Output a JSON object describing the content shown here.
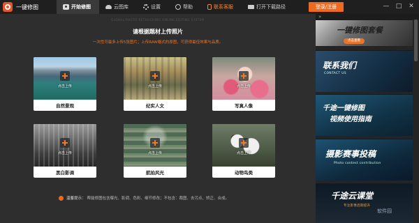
{
  "app": {
    "title": "一键修图"
  },
  "nav": {
    "items": [
      {
        "label": "开始修图",
        "icon": "camera-icon",
        "active": true
      },
      {
        "label": "云图库",
        "icon": "cloud-icon"
      },
      {
        "label": "设置",
        "icon": "gear-icon"
      },
      {
        "label": "帮助",
        "icon": "help-icon"
      },
      {
        "label": "联系客服",
        "icon": "phone-icon",
        "color": "#f08a3c"
      },
      {
        "label": "打开下载路径",
        "icon": "folder-icon"
      }
    ],
    "login_label": "登录/注册"
  },
  "window_controls": {
    "minimize": "—",
    "maximize": "□",
    "close": "✕"
  },
  "main": {
    "watermark": "GLOBAL PHOTO RETOUCHING ONLINE EDITING SYSTEM",
    "upload_title": "请根据题材上传照片",
    "upload_hint": "一次性可最多上传5张图片；上传RAW格式的原图，可获得最佳效果与品质。",
    "upload_action": "点击上传",
    "categories": [
      {
        "label": "自然景观"
      },
      {
        "label": "纪实人文"
      },
      {
        "label": "写真人像"
      },
      {
        "label": "黑白影调"
      },
      {
        "label": "航拍风光"
      },
      {
        "label": "动物鸟类"
      }
    ],
    "tip_label": "温馨提示：",
    "tip_text": "帮能修图包含曝光、影调、色彩、细节修改；不包含：裁图、去污点、矫正、合成。"
  },
  "sidebar": {
    "arrows": "»",
    "banners": [
      {
        "title": "一键修图套餐",
        "pill": "点击查看"
      },
      {
        "title": "联系我们",
        "sub": "CONTACT US"
      },
      {
        "title": "千途一键修图",
        "title2": "视频使用指南"
      },
      {
        "title": "摄影赛事投稿",
        "sub": "Photo contest contribution"
      },
      {
        "title": "千途云课堂",
        "sub": "专注影像后期提升"
      }
    ]
  },
  "watermark_corner": "软件园",
  "colors": {
    "accent": "#ef6a1f",
    "titlebar": "#1f1f1f",
    "main_bg": "#2e2e2e"
  }
}
